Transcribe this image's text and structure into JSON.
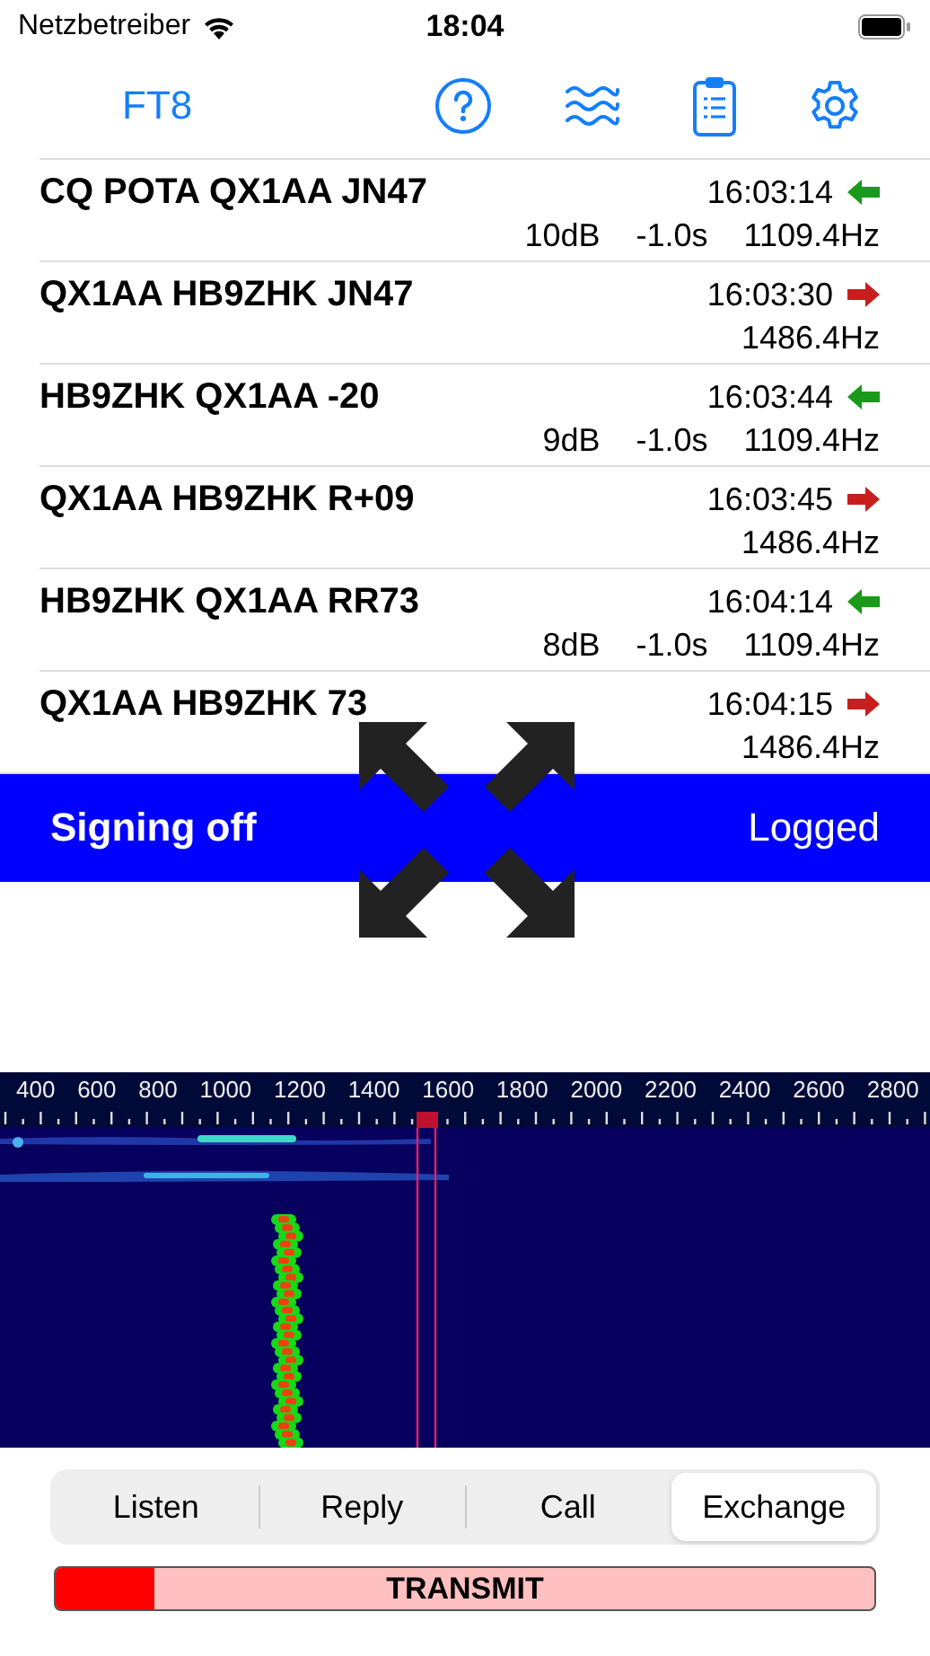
{
  "status_bar": {
    "carrier": "Netzbetreiber",
    "time": "18:04"
  },
  "toolbar": {
    "mode": "FT8"
  },
  "messages": [
    {
      "text": "CQ POTA QX1AA JN47",
      "time": "16:03:14",
      "kind": "rx",
      "snr": "10dB",
      "dt": "-1.0s",
      "freq": "1109.4Hz"
    },
    {
      "text": "QX1AA HB9ZHK JN47",
      "time": "16:03:30",
      "kind": "tx",
      "freq": "1486.4Hz"
    },
    {
      "text": "HB9ZHK QX1AA -20",
      "time": "16:03:44",
      "kind": "rx",
      "snr": "9dB",
      "dt": "-1.0s",
      "freq": "1109.4Hz"
    },
    {
      "text": "QX1AA HB9ZHK R+09",
      "time": "16:03:45",
      "kind": "tx",
      "freq": "1486.4Hz"
    },
    {
      "text": "HB9ZHK QX1AA RR73",
      "time": "16:04:14",
      "kind": "rx",
      "snr": "8dB",
      "dt": "-1.0s",
      "freq": "1109.4Hz"
    },
    {
      "text": "QX1AA HB9ZHK 73",
      "time": "16:04:15",
      "kind": "tx",
      "freq": "1486.4Hz"
    }
  ],
  "banner": {
    "state": "Signing off",
    "status": "Logged"
  },
  "waterfall": {
    "axis_labels": [
      "400",
      "600",
      "800",
      "1000",
      "1200",
      "1400",
      "1600",
      "1800",
      "2000",
      "2200",
      "2400",
      "2600",
      "2800"
    ]
  },
  "segments": [
    {
      "label": "Listen",
      "selected": false
    },
    {
      "label": "Reply",
      "selected": false
    },
    {
      "label": "Call",
      "selected": false
    },
    {
      "label": "Exchange",
      "selected": true
    }
  ],
  "transmit": {
    "label": "TRANSMIT",
    "level": 0.12
  }
}
